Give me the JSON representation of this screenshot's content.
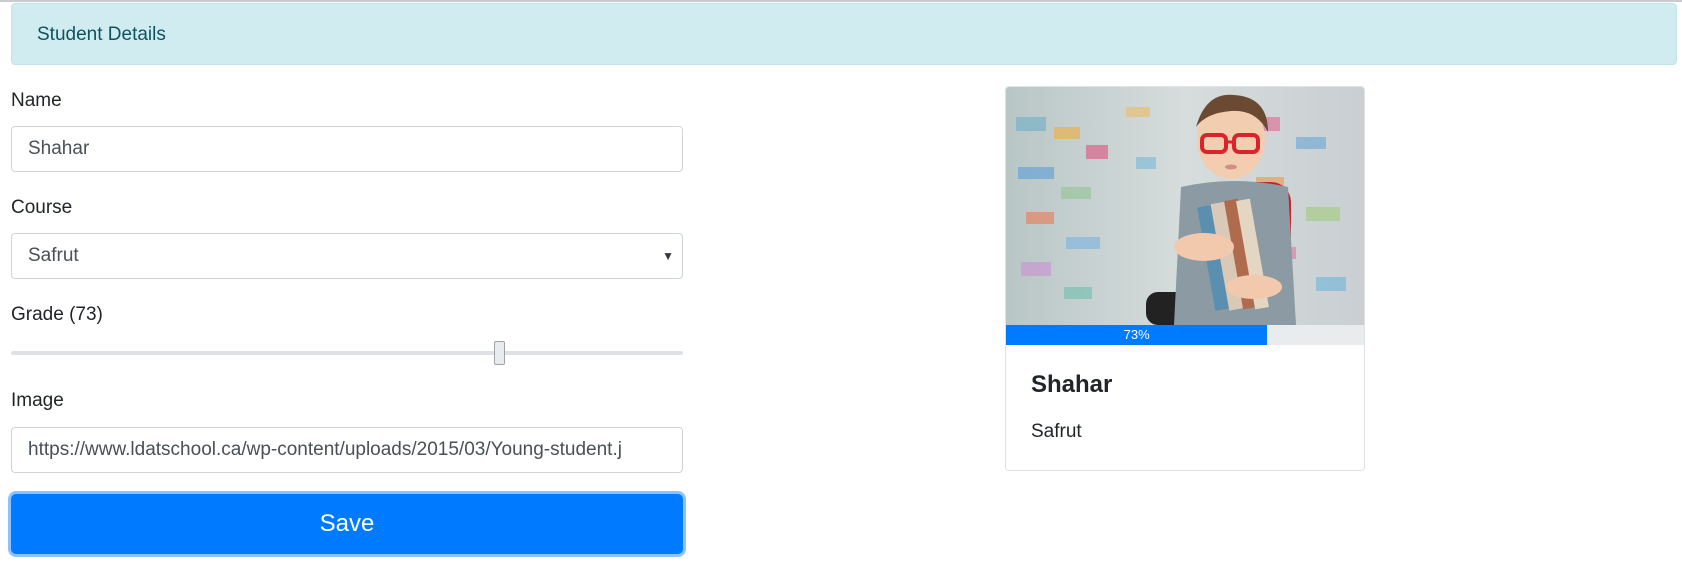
{
  "alert": {
    "text": "Student Details"
  },
  "form": {
    "name_label": "Name",
    "name_value": "Shahar",
    "course_label": "Course",
    "course_selected": "Safrut",
    "grade_label": "Grade (73)",
    "grade_value": 73,
    "grade_max": 100,
    "image_label": "Image",
    "image_value": "https://www.ldatschool.ca/wp-content/uploads/2015/03/Young-student.j",
    "save_label": "Save"
  },
  "card": {
    "progress_value": 73,
    "progress_label": "73%",
    "title": "Shahar",
    "subtitle": "Safrut"
  },
  "colors": {
    "primary": "#007bff",
    "alert_bg": "#d1ecf1",
    "alert_text": "#0c5460"
  }
}
